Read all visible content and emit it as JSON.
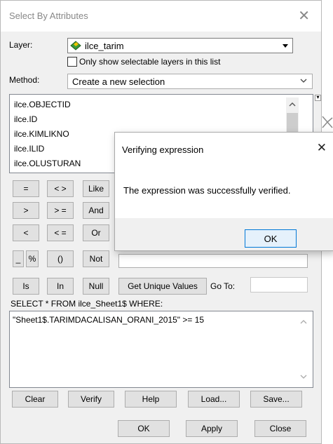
{
  "dialog": {
    "title": "Select By Attributes",
    "close_glyph": "✕",
    "layer_label": "Layer:",
    "layer_value": "ilce_tarim",
    "only_selectable_label": "Only show selectable layers in this list",
    "method_label": "Method:",
    "method_value": "Create a new selection",
    "fields": [
      "ilce.OBJECTID",
      "ilce.ID",
      "ilce.KIMLIKNO",
      "ilce.ILID",
      "ilce.OLUSTURAN"
    ],
    "operators": {
      "eq": "=",
      "ne": "< >",
      "like": "Like",
      "gt": ">",
      "ge": "> =",
      "and": "And",
      "lt": "<",
      "le": "< =",
      "or": "Or",
      "underscore": "_",
      "percent": "%",
      "parens": "()",
      "not": "Not",
      "is": "Is",
      "in": "In",
      "null": "Null"
    },
    "get_unique_values": "Get Unique Values",
    "go_to_label": "Go To:",
    "go_to_value": "",
    "sql_prefix": "SELECT * FROM ilce_Sheet1$ WHERE:",
    "expression": "\"Sheet1$.TARIMDACALISAN_ORANI_2015\" >= 15",
    "buttons": {
      "clear": "Clear",
      "verify": "Verify",
      "help": "Help",
      "load": "Load...",
      "save": "Save..."
    },
    "footer": {
      "ok": "OK",
      "apply": "Apply",
      "close": "Close"
    }
  },
  "popup": {
    "title": "Verifying expression",
    "close_glyph": "✕",
    "message": "The expression was successfully verified.",
    "ok": "OK"
  },
  "colors": {
    "ok_border": "#0078d7",
    "ok_bg": "#e5f1fb",
    "dialog_bg": "#f0f0f0"
  },
  "icons": [
    "layer-icon",
    "dropdown-arrow-icon",
    "scroll-up-icon",
    "scroll-down-icon",
    "toolbox-icon"
  ]
}
